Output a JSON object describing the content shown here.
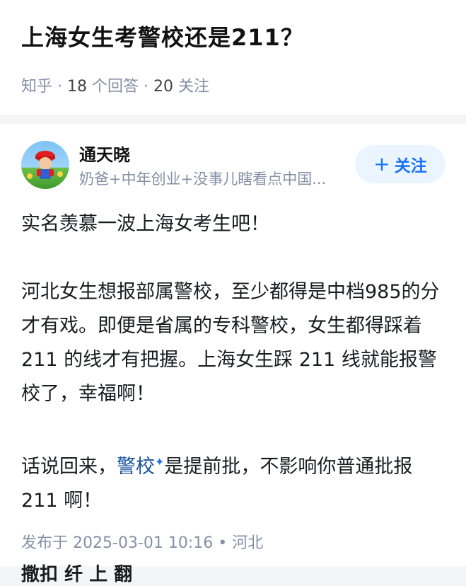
{
  "question": {
    "title": "上海女生考警校还是211？",
    "source": "知乎",
    "answers_count": "18",
    "answers_label": "个回答",
    "followers_count": "20",
    "followers_label": "关注",
    "separator": "·"
  },
  "answer": {
    "author": {
      "name": "通天晓",
      "bio": "奶爸+中年创业+没事儿瞎看点中国..."
    },
    "follow_button": {
      "plus": "+",
      "label": "关注"
    },
    "paragraphs": {
      "p1": "实名羡慕一波上海女考生吧！",
      "p2": "河北女生想报部属警校，至少都得是中档985的分才有戏。即便是省属的专科警校，女生都得踩着 211 的线才有把握。上海女生踩 211 线就能报警校了，幸福啊！",
      "p3_before": "话说回来，",
      "p3_link": "警校",
      "p3_after": "是提前批，不影响你普通批报 211 啊！"
    },
    "publish": {
      "prefix": "发布于",
      "datetime": "2025-03-01 10:16",
      "dot": "•",
      "location": "河北"
    },
    "cutoff_text": "撒扣 纤 上 翻"
  },
  "colors": {
    "brand_blue": "#1772f6",
    "link_blue": "#175199",
    "meta_gray": "#8590a6",
    "follow_bg": "#ebf5ff"
  }
}
